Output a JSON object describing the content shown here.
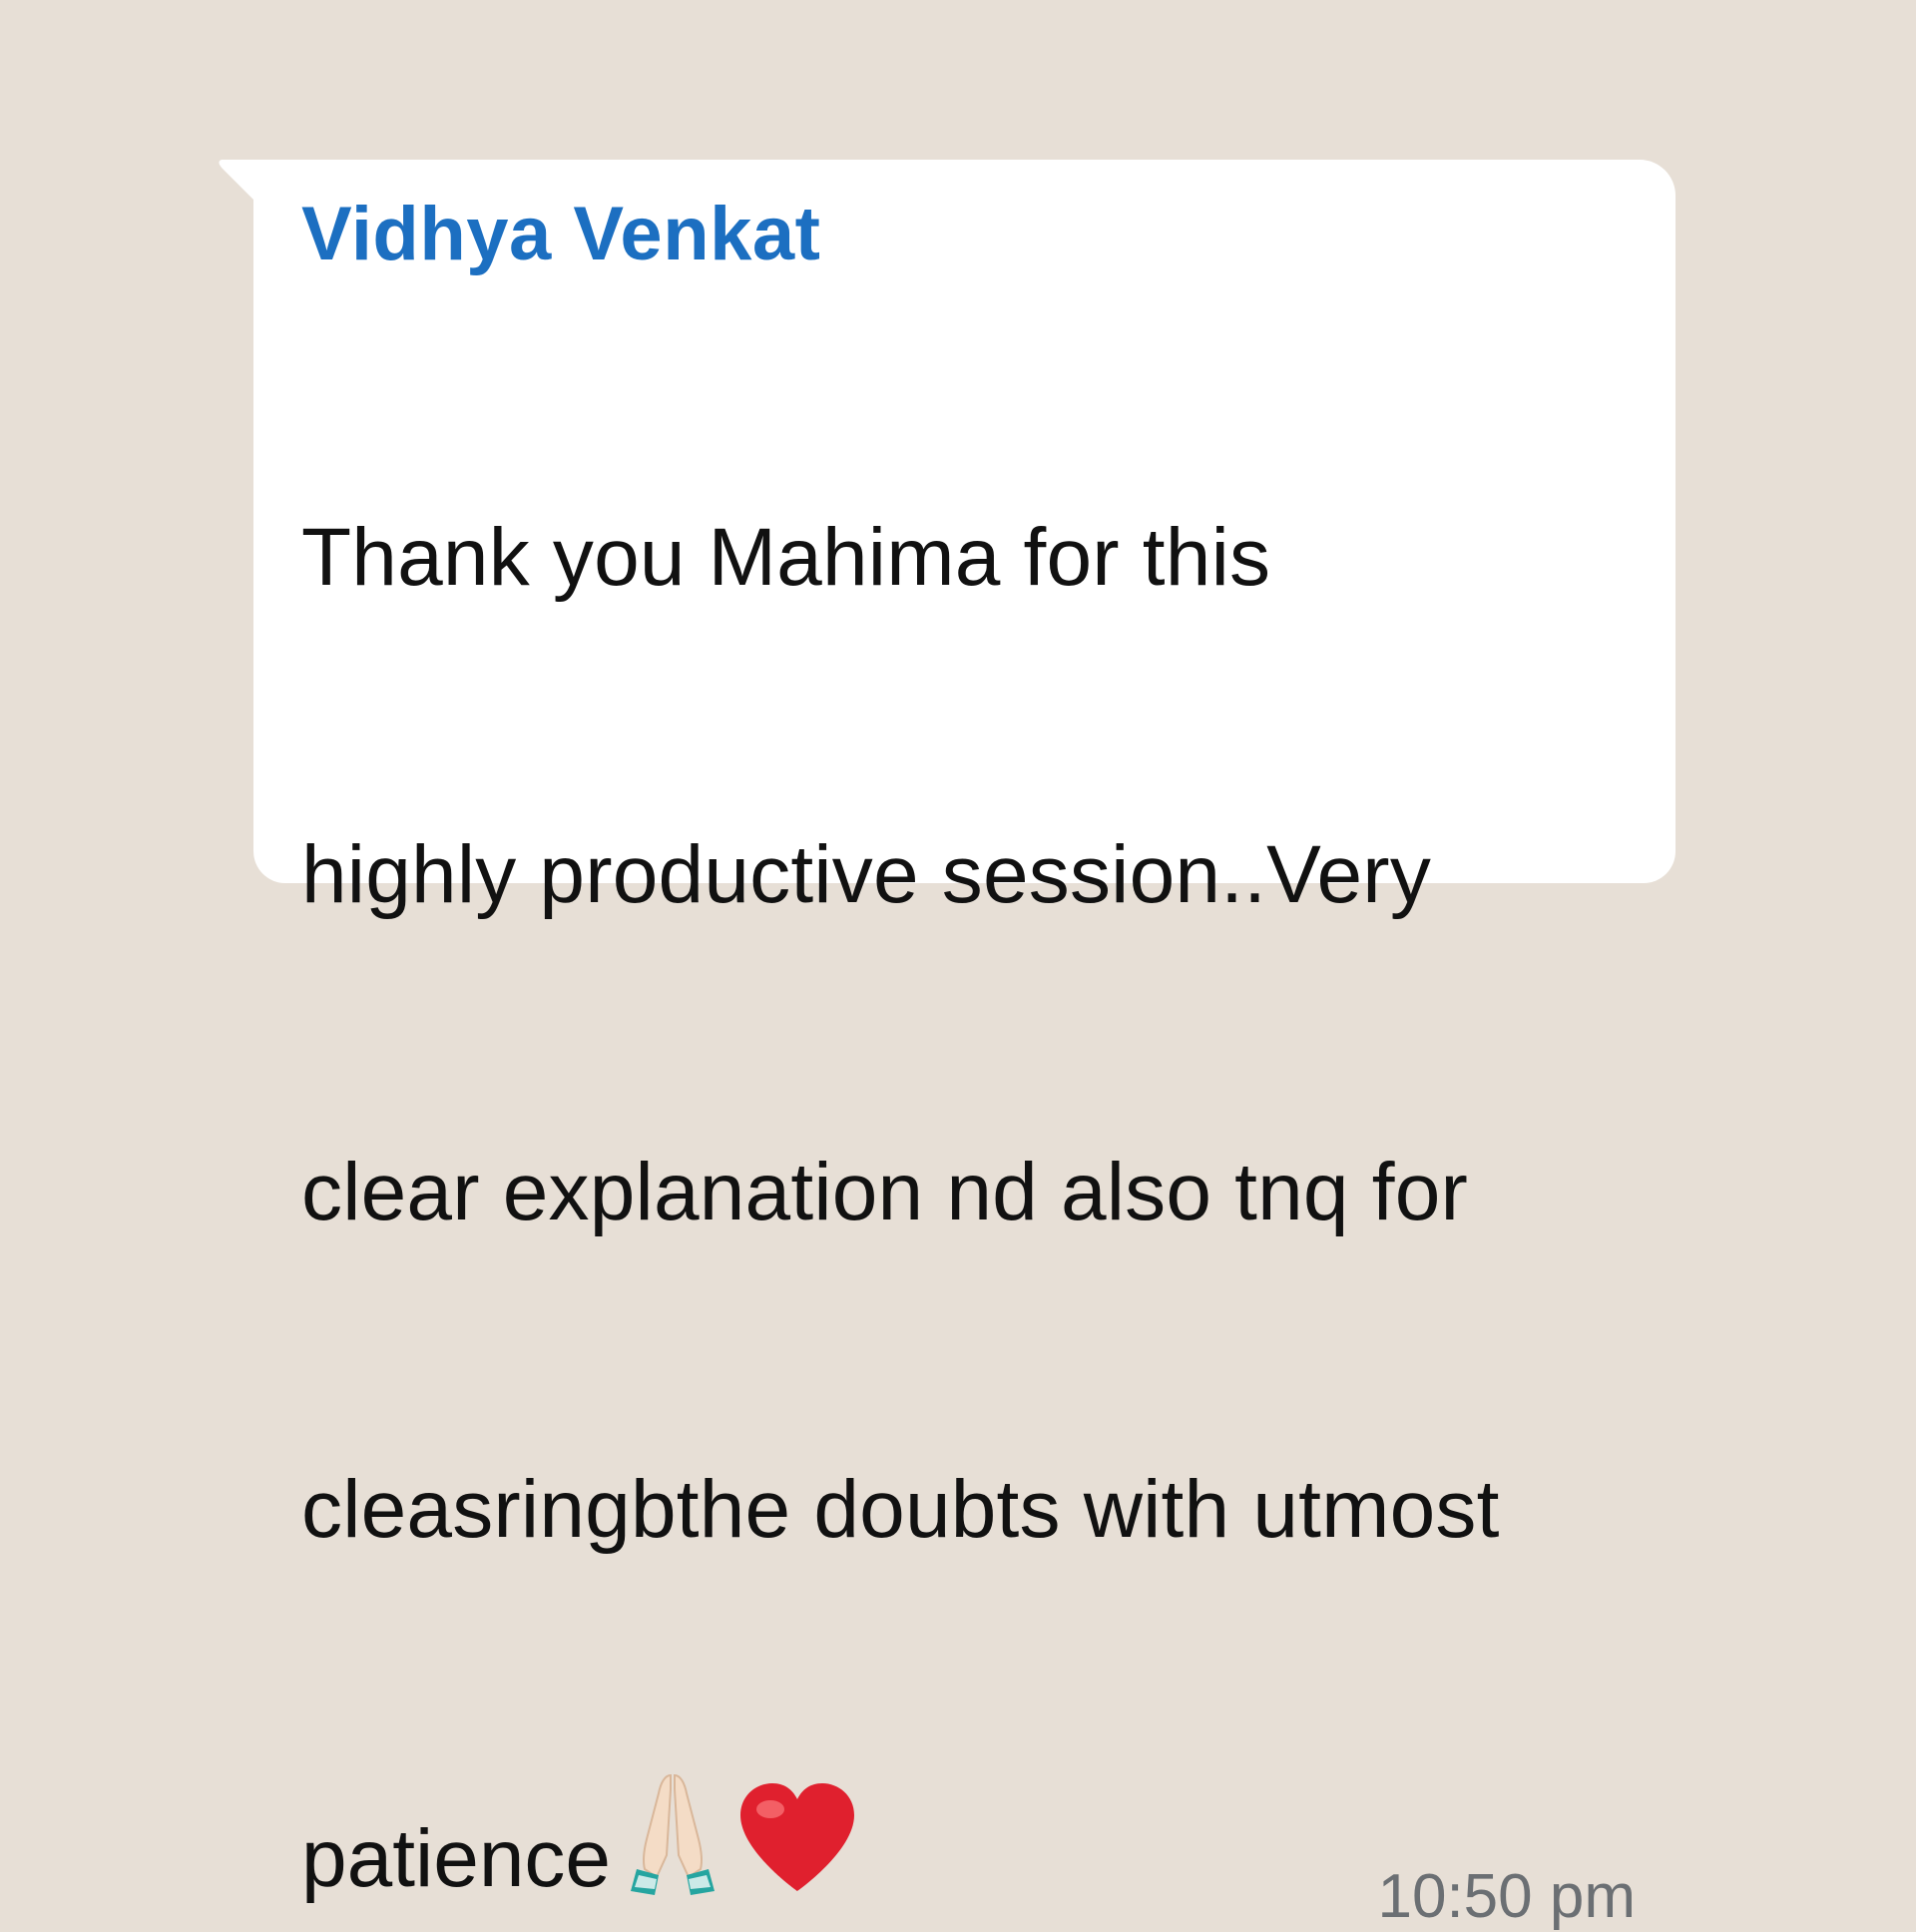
{
  "message": {
    "sender": "Vidhya Venkat",
    "lines": [
      "Thank you Mahima for this",
      "highly productive session..Very",
      "clear explanation nd also tnq for",
      "cleasringbthe doubts with utmost"
    ],
    "last_line": "patience",
    "emojis": [
      "folded-hands-icon",
      "red-heart-icon"
    ],
    "time": "10:50 pm"
  },
  "colors": {
    "background": "#e7dfd6",
    "bubble": "#ffffff",
    "sender": "#1c6fc1",
    "text": "#111111",
    "timestamp": "#6b6f73"
  }
}
